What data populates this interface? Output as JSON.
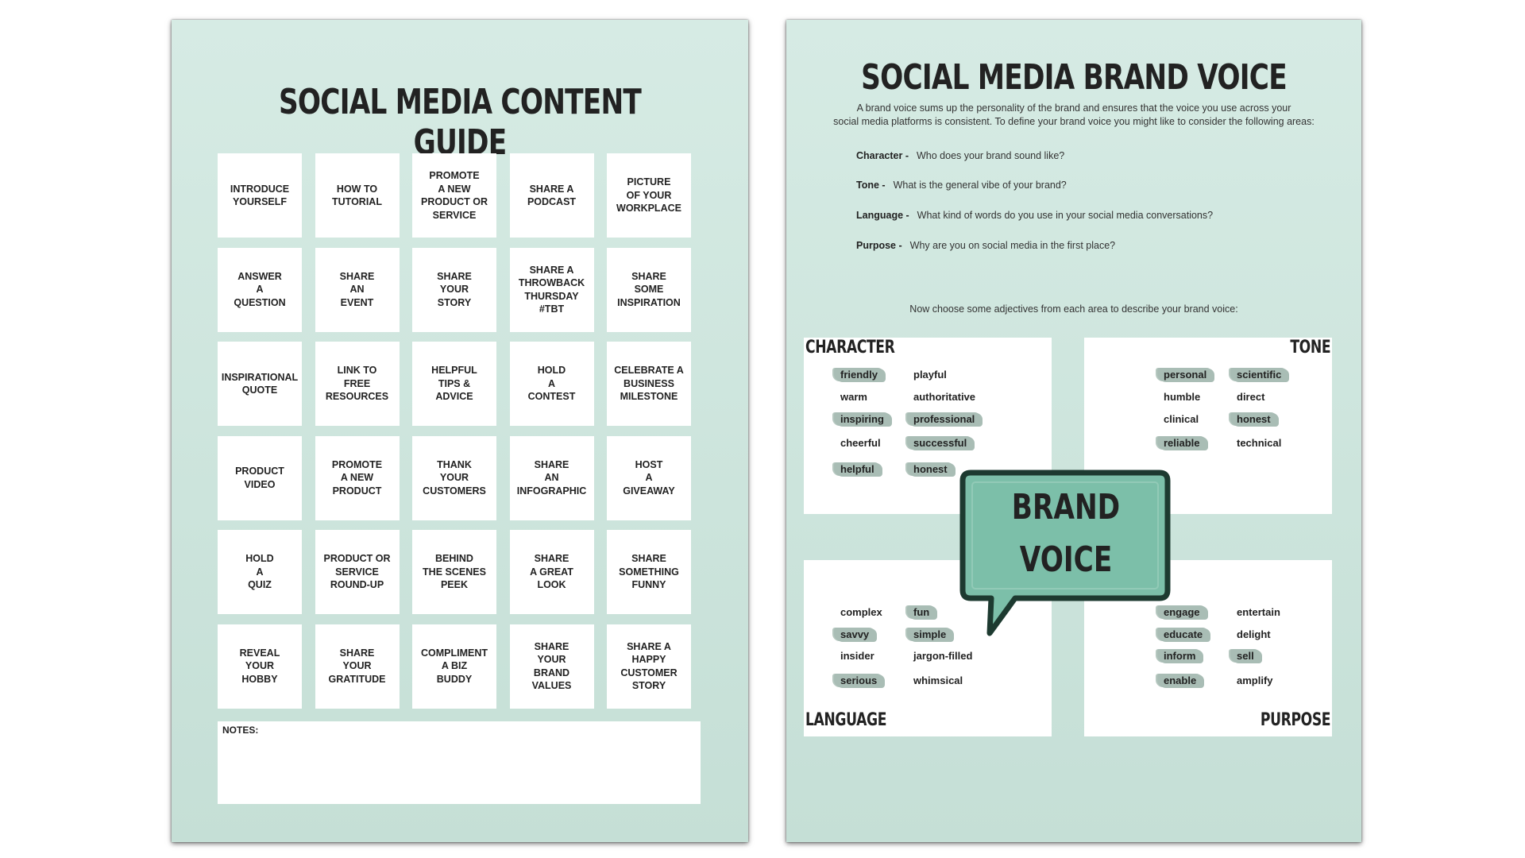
{
  "content_guide": {
    "title": "SOCIAL MEDIA CONTENT GUIDE",
    "cells": [
      "INTRODUCE\nYOURSELF",
      "HOW TO\nTUTORIAL",
      "PROMOTE\nA NEW\nPRODUCT OR\nSERVICE",
      "SHARE A\nPODCAST",
      "PICTURE\nOF YOUR\nWORKPLACE",
      "ANSWER\nA\nQUESTION",
      "SHARE\nAN\nEVENT",
      "SHARE\nYOUR\nSTORY",
      "SHARE A\nTHROWBACK\nTHURSDAY\n#TBT",
      "SHARE\nSOME\nINSPIRATION",
      "INSPIRATIONAL\nQUOTE",
      "LINK TO\nFREE\nRESOURCES",
      "HELPFUL\nTIPS &\nADVICE",
      "HOLD\nA\nCONTEST",
      "CELEBRATE A\nBUSINESS\nMILESTONE",
      "PRODUCT\nVIDEO",
      "PROMOTE\nA NEW\nPRODUCT",
      "THANK\nYOUR\nCUSTOMERS",
      "SHARE\nAN\nINFOGRAPHIC",
      "HOST\nA\nGIVEAWAY",
      "HOLD\nA\nQUIZ",
      "PRODUCT OR\nSERVICE\nROUND-UP",
      "BEHIND\nTHE SCENES\nPEEK",
      "SHARE\nA GREAT\nLOOK",
      "SHARE\nSOMETHING\nFUNNY",
      "REVEAL\nYOUR\nHOBBY",
      "SHARE\nYOUR\nGRATITUDE",
      "COMPLIMENT\nA BIZ\nBUDDY",
      "SHARE\nYOUR\nBRAND\nVALUES",
      "SHARE A\nHAPPY\nCUSTOMER\nSTORY"
    ],
    "notes_label": "NOTES:"
  },
  "brand_voice": {
    "title": "SOCIAL MEDIA BRAND VOICE",
    "intro_line1": "A brand voice sums up the personality of the brand and ensures that the voice you use across your",
    "intro_line2": "social media platforms is consistent. To define your brand voice you might like to consider the following areas:",
    "questions": [
      {
        "label": "Character -",
        "text": "Who does your brand sound like?"
      },
      {
        "label": "Tone -",
        "text": "What is the general vibe of your brand?"
      },
      {
        "label": "Language -",
        "text": "What kind of words do you use in your social media conversations?"
      },
      {
        "label": "Purpose -",
        "text": "Why are you on social media in the first place?"
      }
    ],
    "choose_text": "Now choose some adjectives from each area to describe your brand voice:",
    "character": {
      "label": "CHARACTER",
      "words": [
        {
          "text": "friendly",
          "highlighted": true
        },
        {
          "text": "playful",
          "highlighted": false
        },
        {
          "text": "warm",
          "highlighted": false
        },
        {
          "text": "authoritative",
          "highlighted": false
        },
        {
          "text": "inspiring",
          "highlighted": true
        },
        {
          "text": "professional",
          "highlighted": true
        },
        {
          "text": "cheerful",
          "highlighted": false
        },
        {
          "text": "successful",
          "highlighted": true
        },
        {
          "text": "helpful",
          "highlighted": true
        },
        {
          "text": "honest",
          "highlighted": true
        }
      ]
    },
    "tone": {
      "label": "TONE",
      "words": [
        {
          "text": "personal",
          "highlighted": true
        },
        {
          "text": "scientific",
          "highlighted": true
        },
        {
          "text": "humble",
          "highlighted": false
        },
        {
          "text": "direct",
          "highlighted": false
        },
        {
          "text": "clinical",
          "highlighted": false
        },
        {
          "text": "honest",
          "highlighted": true
        },
        {
          "text": "reliable",
          "highlighted": true
        },
        {
          "text": "technical",
          "highlighted": false
        }
      ]
    },
    "language": {
      "label": "LANGUAGE",
      "words": [
        {
          "text": "complex",
          "highlighted": false
        },
        {
          "text": "fun",
          "highlighted": true
        },
        {
          "text": "savvy",
          "highlighted": true
        },
        {
          "text": "simple",
          "highlighted": true
        },
        {
          "text": "insider",
          "highlighted": false
        },
        {
          "text": "jargon-filled",
          "highlighted": false
        },
        {
          "text": "serious",
          "highlighted": true
        },
        {
          "text": "whimsical",
          "highlighted": false
        }
      ]
    },
    "purpose": {
      "label": "PURPOSE",
      "words": [
        {
          "text": "engage",
          "highlighted": true
        },
        {
          "text": "entertain",
          "highlighted": false
        },
        {
          "text": "educate",
          "highlighted": true
        },
        {
          "text": "delight",
          "highlighted": false
        },
        {
          "text": "inform",
          "highlighted": true
        },
        {
          "text": "sell",
          "highlighted": true
        },
        {
          "text": "enable",
          "highlighted": true
        },
        {
          "text": "amplify",
          "highlighted": false
        }
      ]
    },
    "bubble_line1": "BRAND",
    "bubble_line2": "VOICE"
  },
  "colors": {
    "page_bg": "#d6ebe4",
    "highlight": "#a9bdb5",
    "bubble_fill": "#7cbfa9",
    "bubble_outline": "#1d3a30"
  }
}
